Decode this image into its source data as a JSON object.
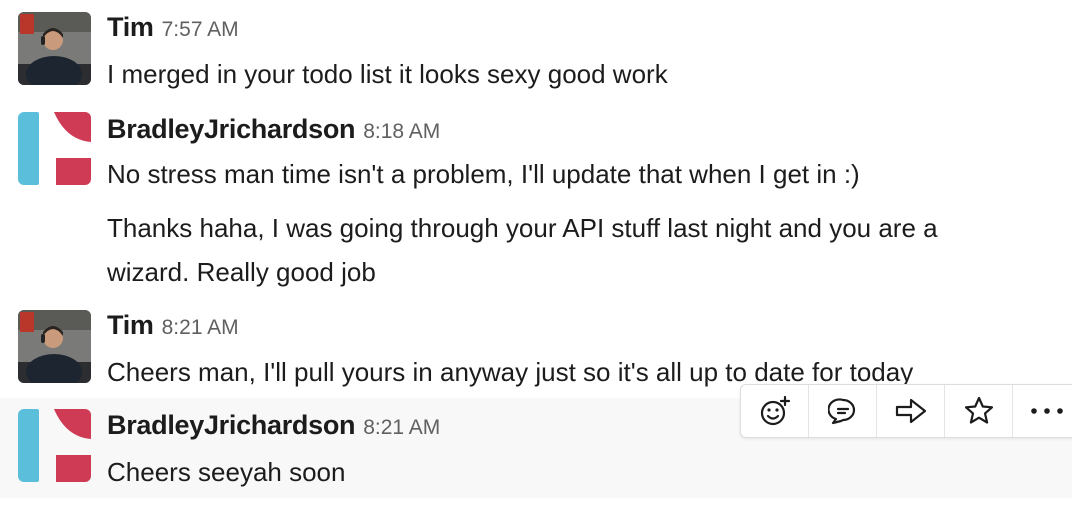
{
  "messages": [
    {
      "user": "Tim",
      "time": "7:57 AM",
      "avatar": "photo",
      "lines": [
        "I merged in your todo list it looks sexy good work"
      ]
    },
    {
      "user": "BradleyJrichardson",
      "time": "8:18 AM",
      "avatar": "logo",
      "lines": [
        "No stress man time isn't a problem, I'll update that when I get in :)"
      ]
    },
    {
      "user": null,
      "time": null,
      "avatar": null,
      "lines": [
        "Thanks haha, I was going through your API stuff last night and you are a",
        "wizard. Really good job"
      ]
    },
    {
      "user": "Tim",
      "time": "8:21 AM",
      "avatar": "photo",
      "lines": [
        "Cheers man, I'll pull yours in anyway just so it's all up to date for today"
      ]
    },
    {
      "user": "BradleyJrichardson",
      "time": "8:21 AM",
      "avatar": "logo",
      "lines": [
        "Cheers seeyah soon"
      ]
    }
  ],
  "toolbar": {
    "actions": [
      "add-reaction-icon",
      "reply-in-thread-icon",
      "share-message-icon",
      "save-star-icon",
      "more-actions-icon"
    ]
  },
  "colors": {
    "logo_blue": "#5bbfdc",
    "logo_red": "#cf3a54",
    "hover_background": "#f8f8f8",
    "timestamp": "#616061"
  }
}
